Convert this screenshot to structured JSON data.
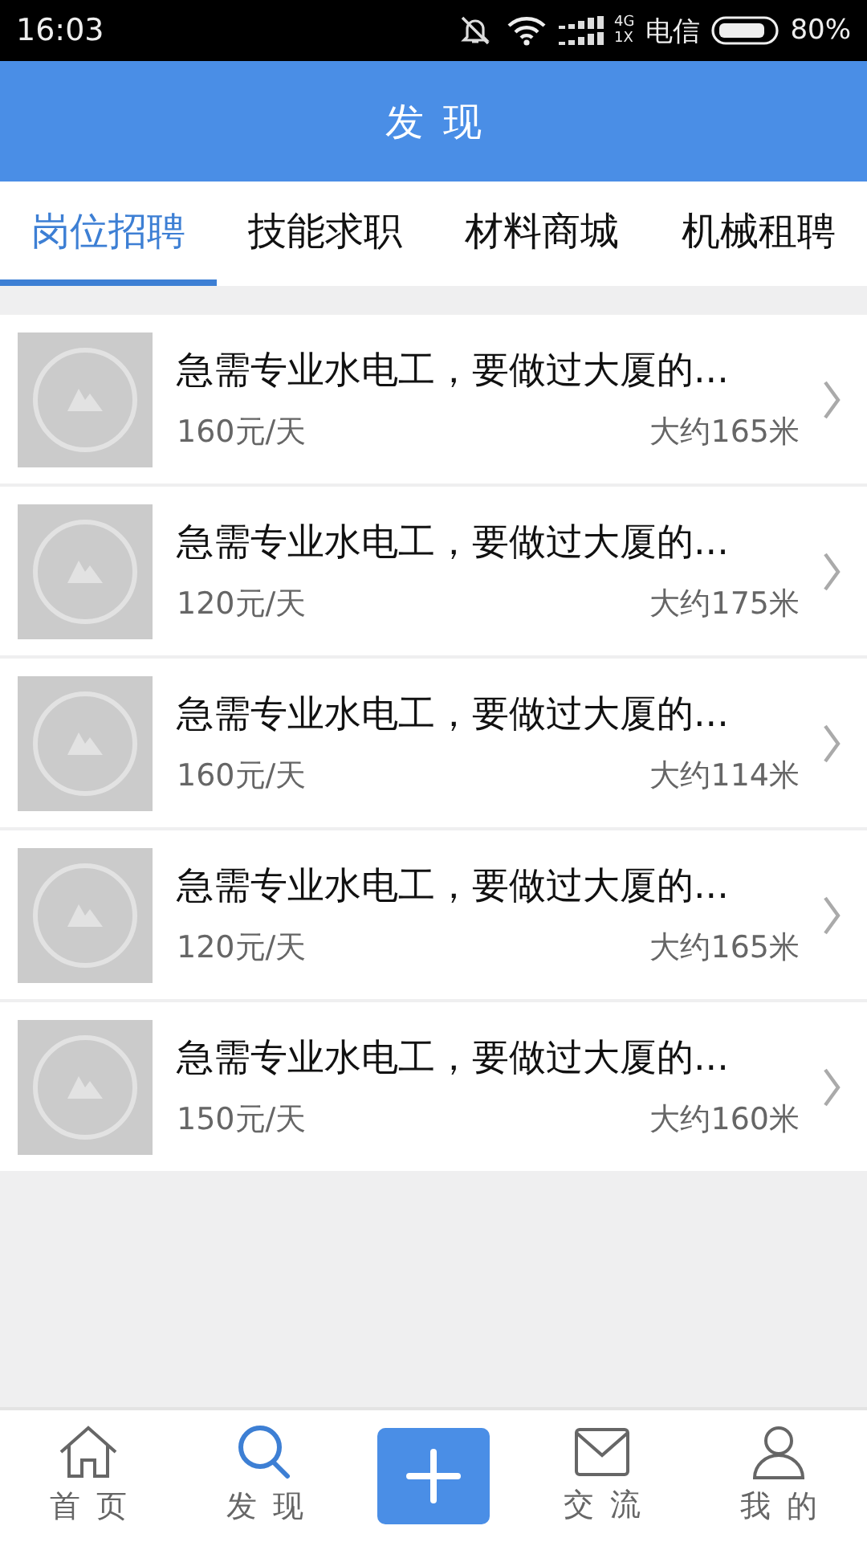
{
  "status_bar": {
    "time": "16:03",
    "network_top": "4G",
    "network_bottom": "1X",
    "carrier": "电信",
    "battery": "80%"
  },
  "header": {
    "title": "发现"
  },
  "tabs": [
    {
      "label": "岗位招聘",
      "selected": true
    },
    {
      "label": "技能求职",
      "selected": false
    },
    {
      "label": "材料商城",
      "selected": false
    },
    {
      "label": "机械租聘",
      "selected": false
    }
  ],
  "listings": [
    {
      "title": "急需专业水电工，要做过大厦的...",
      "price": "160元/天",
      "distance": "大约165米"
    },
    {
      "title": "急需专业水电工，要做过大厦的...",
      "price": "120元/天",
      "distance": "大约175米"
    },
    {
      "title": "急需专业水电工，要做过大厦的...",
      "price": "160元/天",
      "distance": "大约114米"
    },
    {
      "title": "急需专业水电工，要做过大厦的...",
      "price": "120元/天",
      "distance": "大约165米"
    },
    {
      "title": "急需专业水电工，要做过大厦的...",
      "price": "150元/天",
      "distance": "大约160米"
    }
  ],
  "bottom_nav": [
    {
      "kind": "home",
      "label": "首页",
      "selected": false
    },
    {
      "kind": "search",
      "label": "发现",
      "selected": true
    },
    {
      "kind": "add",
      "selected": false
    },
    {
      "kind": "mail",
      "label": "交流",
      "selected": false
    },
    {
      "kind": "user",
      "label": "我的",
      "selected": false
    }
  ]
}
